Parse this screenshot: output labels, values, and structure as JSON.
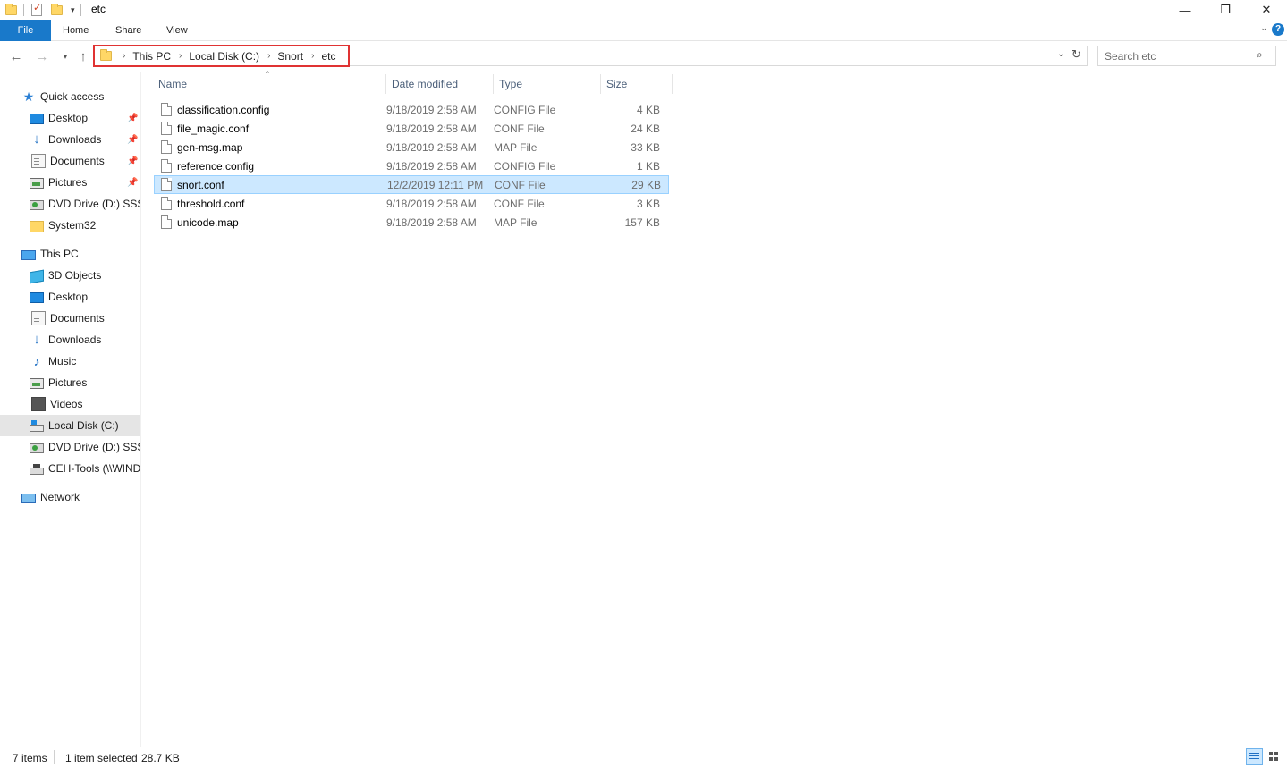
{
  "window": {
    "title": "etc",
    "minimize_glyph": "—",
    "maximize_glyph": "❐",
    "close_glyph": "✕"
  },
  "ribbon": {
    "tabs": [
      {
        "label": "File"
      },
      {
        "label": "Home"
      },
      {
        "label": "Share"
      },
      {
        "label": "View"
      }
    ],
    "help_glyph": "?"
  },
  "address": {
    "breadcrumb": [
      "This PC",
      "Local Disk (C:)",
      "Snort",
      "etc"
    ],
    "search_placeholder": "Search etc"
  },
  "navigation": {
    "quick_access": {
      "label": "Quick access",
      "icon": "star-icon"
    },
    "quick_items": [
      {
        "label": "Desktop",
        "icon": "desktop-icon",
        "pinned": true
      },
      {
        "label": "Downloads",
        "icon": "downloads-icon",
        "pinned": true
      },
      {
        "label": "Documents",
        "icon": "documents-icon",
        "pinned": true
      },
      {
        "label": "Pictures",
        "icon": "pictures-icon",
        "pinned": true
      },
      {
        "label": "DVD Drive (D:) SSS_X",
        "icon": "dvd-icon",
        "pinned": false
      },
      {
        "label": "System32",
        "icon": "folder-icon",
        "pinned": false
      }
    ],
    "this_pc": {
      "label": "This PC",
      "icon": "computer-icon"
    },
    "pc_items": [
      {
        "label": "3D Objects",
        "icon": "3d-objects-icon"
      },
      {
        "label": "Desktop",
        "icon": "desktop-icon"
      },
      {
        "label": "Documents",
        "icon": "documents-icon"
      },
      {
        "label": "Downloads",
        "icon": "downloads-icon"
      },
      {
        "label": "Music",
        "icon": "music-icon"
      },
      {
        "label": "Pictures",
        "icon": "pictures-icon"
      },
      {
        "label": "Videos",
        "icon": "videos-icon"
      },
      {
        "label": "Local Disk (C:)",
        "icon": "local-disk-icon",
        "selected": true
      },
      {
        "label": "DVD Drive (D:) SSS_X",
        "icon": "dvd-icon"
      },
      {
        "label": "CEH-Tools (\\\\WINDOWS",
        "icon": "network-drive-icon"
      }
    ],
    "network": {
      "label": "Network",
      "icon": "network-icon"
    }
  },
  "columns": {
    "name": "Name",
    "date": "Date modified",
    "type": "Type",
    "size": "Size"
  },
  "files": [
    {
      "name": "classification.config",
      "date": "9/18/2019 2:58 AM",
      "type": "CONFIG File",
      "size": "4 KB"
    },
    {
      "name": "file_magic.conf",
      "date": "9/18/2019 2:58 AM",
      "type": "CONF File",
      "size": "24 KB"
    },
    {
      "name": "gen-msg.map",
      "date": "9/18/2019 2:58 AM",
      "type": "MAP File",
      "size": "33 KB"
    },
    {
      "name": "reference.config",
      "date": "9/18/2019 2:58 AM",
      "type": "CONFIG File",
      "size": "1 KB"
    },
    {
      "name": "snort.conf",
      "date": "12/2/2019 12:11 PM",
      "type": "CONF File",
      "size": "29 KB",
      "selected": true
    },
    {
      "name": "threshold.conf",
      "date": "9/18/2019 2:58 AM",
      "type": "CONF File",
      "size": "3 KB"
    },
    {
      "name": "unicode.map",
      "date": "9/18/2019 2:58 AM",
      "type": "MAP File",
      "size": "157 KB"
    }
  ],
  "status": {
    "item_count": "7 items",
    "selection": "1 item selected",
    "selection_size": "28.7 KB"
  },
  "colors": {
    "accent": "#1979ca",
    "selection_bg": "#cce8ff",
    "highlight_box": "#e03333"
  }
}
